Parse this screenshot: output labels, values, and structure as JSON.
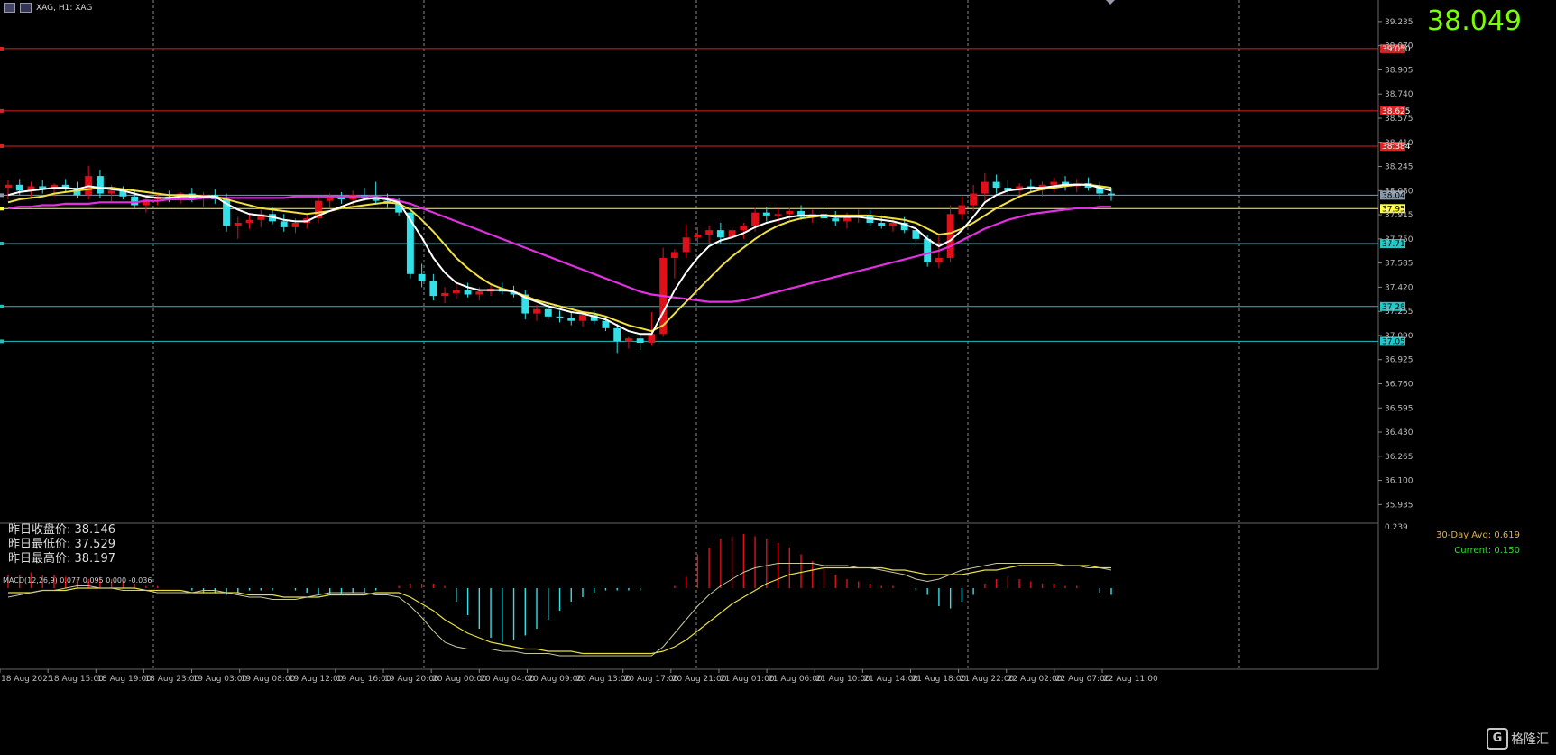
{
  "header": {
    "title": "XAG, H1: XAG"
  },
  "current_price": "38.049",
  "stats": {
    "prev_close": "昨日收盘价: 38.146",
    "prev_low": "昨日最低价: 37.529",
    "prev_high": "昨日最高价: 38.197"
  },
  "avg_panel": {
    "avg30": "30-Day Avg: 0.619",
    "current": "Current: 0.150"
  },
  "macd": {
    "label": "MACD(12,26,9) 0.077 0.095 0.000 -0.036",
    "top_tick": "0.239"
  },
  "watermark": {
    "text": "格隆汇",
    "mark": "G"
  },
  "colors": {
    "bg": "#000000",
    "bull": "#e0101a",
    "bear": "#33e0e8",
    "ma_fast": "#ffffff",
    "ma_mid": "#f0e040",
    "ma_slow": "#e030e0",
    "res_line": "#dd2020",
    "sup_line": "#20c0c0",
    "cur_line": "#8899aa",
    "ma_line": "#ffff44"
  },
  "chart_data": {
    "type": "candlestick",
    "symbol": "XAG",
    "timeframe": "H1",
    "ylim": [
      35.82,
      39.37
    ],
    "y_ticks": [
      "39.235",
      "39.070",
      "38.905",
      "38.740",
      "38.575",
      "38.410",
      "38.245",
      "38.080",
      "37.915",
      "37.750",
      "37.585",
      "37.420",
      "37.255",
      "37.090",
      "36.925",
      "36.760",
      "36.595",
      "36.430",
      "36.265",
      "36.100",
      "35.935"
    ],
    "x_labels": [
      "18 Aug 2025",
      "18 Aug 15:00",
      "18 Aug 19:00",
      "18 Aug 23:00",
      "19 Aug 03:00",
      "19 Aug 08:00",
      "19 Aug 12:00",
      "19 Aug 16:00",
      "19 Aug 20:00",
      "20 Aug 00:00",
      "20 Aug 04:00",
      "20 Aug 09:00",
      "20 Aug 13:00",
      "20 Aug 17:00",
      "20 Aug 21:00",
      "21 Aug 01:00",
      "21 Aug 06:00",
      "21 Aug 10:00",
      "21 Aug 14:00",
      "21 Aug 18:00",
      "21 Aug 22:00",
      "22 Aug 02:00",
      "22 Aug 07:00",
      "22 Aug 11:00"
    ],
    "h_levels": [
      {
        "value": 39.05,
        "label": "39.050",
        "kind": "res"
      },
      {
        "value": 38.625,
        "label": "38.625",
        "kind": "res"
      },
      {
        "value": 38.384,
        "label": "38.384",
        "kind": "res"
      },
      {
        "value": 38.049,
        "label": "38.049",
        "kind": "cur"
      },
      {
        "value": 37.957,
        "label": "37.957",
        "kind": "ma"
      },
      {
        "value": 37.718,
        "label": "37.718",
        "kind": "sup"
      },
      {
        "value": 37.288,
        "label": "37.288",
        "kind": "sup"
      },
      {
        "value": 37.05,
        "label": "37.050",
        "kind": "sup"
      }
    ],
    "candles": [
      [
        38.1,
        38.15,
        38.02,
        38.12
      ],
      [
        38.12,
        38.16,
        38.05,
        38.08
      ],
      [
        38.08,
        38.14,
        38.03,
        38.11
      ],
      [
        38.11,
        38.15,
        38.06,
        38.09
      ],
      [
        38.09,
        38.13,
        38.04,
        38.12
      ],
      [
        38.12,
        38.16,
        38.07,
        38.1
      ],
      [
        38.1,
        38.14,
        38.03,
        38.05
      ],
      [
        38.05,
        38.25,
        38.02,
        38.18
      ],
      [
        38.18,
        38.22,
        38.03,
        38.06
      ],
      [
        38.06,
        38.12,
        38.0,
        38.08
      ],
      [
        38.08,
        38.11,
        38.02,
        38.04
      ],
      [
        38.04,
        38.08,
        37.96,
        37.98
      ],
      [
        37.98,
        38.05,
        37.93,
        38.02
      ],
      [
        38.02,
        38.06,
        37.98,
        38.04
      ],
      [
        38.04,
        38.08,
        38.0,
        38.02
      ],
      [
        38.02,
        38.07,
        37.99,
        38.06
      ],
      [
        38.06,
        38.1,
        38.0,
        38.03
      ],
      [
        38.03,
        38.07,
        37.97,
        38.05
      ],
      [
        38.05,
        38.09,
        37.99,
        38.02
      ],
      [
        38.02,
        38.06,
        37.8,
        37.84
      ],
      [
        37.84,
        37.9,
        37.75,
        37.86
      ],
      [
        37.86,
        37.92,
        37.82,
        37.88
      ],
      [
        37.88,
        37.95,
        37.83,
        37.92
      ],
      [
        37.92,
        37.97,
        37.85,
        37.87
      ],
      [
        37.87,
        37.92,
        37.8,
        37.83
      ],
      [
        37.83,
        37.89,
        37.79,
        37.86
      ],
      [
        37.86,
        37.92,
        37.82,
        37.89
      ],
      [
        37.89,
        38.04,
        37.86,
        38.01
      ],
      [
        38.01,
        38.06,
        37.96,
        38.04
      ],
      [
        38.04,
        38.07,
        37.99,
        38.02
      ],
      [
        38.02,
        38.08,
        37.98,
        38.05
      ],
      [
        38.05,
        38.1,
        38.01,
        38.03
      ],
      [
        38.03,
        38.14,
        37.99,
        38.01
      ],
      [
        38.01,
        38.06,
        37.96,
        37.99
      ],
      [
        37.99,
        38.03,
        37.91,
        37.93
      ],
      [
        37.93,
        37.97,
        37.48,
        37.51
      ],
      [
        37.51,
        37.58,
        37.42,
        37.46
      ],
      [
        37.46,
        37.51,
        37.33,
        37.36
      ],
      [
        37.36,
        37.42,
        37.31,
        37.38
      ],
      [
        37.38,
        37.44,
        37.34,
        37.4
      ],
      [
        37.4,
        37.45,
        37.35,
        37.37
      ],
      [
        37.37,
        37.42,
        37.33,
        37.39
      ],
      [
        37.39,
        37.44,
        37.36,
        37.41
      ],
      [
        37.41,
        37.45,
        37.37,
        37.39
      ],
      [
        37.39,
        37.43,
        37.35,
        37.37
      ],
      [
        37.37,
        37.4,
        37.2,
        37.24
      ],
      [
        37.24,
        37.3,
        37.19,
        37.27
      ],
      [
        37.27,
        37.31,
        37.2,
        37.22
      ],
      [
        37.22,
        37.26,
        37.18,
        37.21
      ],
      [
        37.21,
        37.25,
        37.16,
        37.19
      ],
      [
        37.19,
        37.25,
        37.15,
        37.23
      ],
      [
        37.23,
        37.26,
        37.17,
        37.19
      ],
      [
        37.19,
        37.22,
        37.12,
        37.14
      ],
      [
        37.14,
        37.17,
        36.97,
        37.05
      ],
      [
        37.05,
        37.08,
        37.0,
        37.07
      ],
      [
        37.07,
        37.1,
        36.99,
        37.04
      ],
      [
        37.04,
        37.25,
        37.02,
        37.1
      ],
      [
        37.1,
        37.69,
        37.08,
        37.62
      ],
      [
        37.62,
        37.68,
        37.48,
        37.66
      ],
      [
        37.66,
        37.85,
        37.62,
        37.76
      ],
      [
        37.76,
        37.83,
        37.7,
        37.78
      ],
      [
        37.78,
        37.84,
        37.72,
        37.81
      ],
      [
        37.81,
        37.86,
        37.72,
        37.76
      ],
      [
        37.76,
        37.83,
        37.72,
        37.81
      ],
      [
        37.81,
        37.86,
        37.75,
        37.84
      ],
      [
        37.84,
        37.96,
        37.8,
        37.93
      ],
      [
        37.93,
        37.97,
        37.87,
        37.91
      ],
      [
        37.91,
        37.96,
        37.86,
        37.92
      ],
      [
        37.92,
        37.96,
        37.88,
        37.94
      ],
      [
        37.94,
        37.98,
        37.88,
        37.9
      ],
      [
        37.9,
        37.95,
        37.86,
        37.92
      ],
      [
        37.92,
        37.97,
        37.87,
        37.89
      ],
      [
        37.89,
        37.94,
        37.84,
        37.87
      ],
      [
        37.87,
        37.93,
        37.82,
        37.9
      ],
      [
        37.9,
        37.95,
        37.86,
        37.91
      ],
      [
        37.91,
        37.95,
        37.84,
        37.86
      ],
      [
        37.86,
        37.91,
        37.82,
        37.84
      ],
      [
        37.84,
        37.89,
        37.8,
        37.86
      ],
      [
        37.86,
        37.9,
        37.79,
        37.81
      ],
      [
        37.81,
        37.85,
        37.7,
        37.75
      ],
      [
        37.75,
        37.78,
        37.56,
        37.59
      ],
      [
        37.59,
        37.78,
        37.55,
        37.62
      ],
      [
        37.62,
        37.98,
        37.59,
        37.92
      ],
      [
        37.92,
        38.04,
        37.88,
        37.98
      ],
      [
        37.98,
        38.12,
        37.94,
        38.06
      ],
      [
        38.06,
        38.2,
        38.01,
        38.14
      ],
      [
        38.14,
        38.19,
        38.06,
        38.1
      ],
      [
        38.1,
        38.15,
        38.05,
        38.08
      ],
      [
        38.08,
        38.13,
        38.04,
        38.11
      ],
      [
        38.11,
        38.16,
        38.07,
        38.09
      ],
      [
        38.09,
        38.14,
        38.04,
        38.12
      ],
      [
        38.12,
        38.17,
        38.07,
        38.14
      ],
      [
        38.14,
        38.18,
        38.08,
        38.11
      ],
      [
        38.11,
        38.16,
        38.07,
        38.13
      ],
      [
        38.13,
        38.17,
        38.08,
        38.1
      ],
      [
        38.1,
        38.14,
        38.02,
        38.06
      ],
      [
        38.06,
        38.1,
        38.01,
        38.05
      ]
    ],
    "ma_fast": [
      38.05,
      38.07,
      38.08,
      38.09,
      38.1,
      38.1,
      38.09,
      38.11,
      38.1,
      38.09,
      38.08,
      38.06,
      38.04,
      38.03,
      38.03,
      38.04,
      38.04,
      38.04,
      38.04,
      37.99,
      37.95,
      37.92,
      37.91,
      37.9,
      37.88,
      37.87,
      37.87,
      37.91,
      37.94,
      37.97,
      38.0,
      38.02,
      38.03,
      38.02,
      38.0,
      37.88,
      37.76,
      37.62,
      37.52,
      37.45,
      37.42,
      37.4,
      37.4,
      37.4,
      37.39,
      37.35,
      37.32,
      37.29,
      37.27,
      37.25,
      37.24,
      37.22,
      37.2,
      37.16,
      37.12,
      37.1,
      37.1,
      37.25,
      37.4,
      37.52,
      37.62,
      37.7,
      37.74,
      37.76,
      37.79,
      37.83,
      37.86,
      37.88,
      37.9,
      37.91,
      37.91,
      37.91,
      37.9,
      37.9,
      37.9,
      37.89,
      37.88,
      37.87,
      37.85,
      37.82,
      37.75,
      37.7,
      37.74,
      37.81,
      37.9,
      38.0,
      38.05,
      38.08,
      38.09,
      38.1,
      38.1,
      38.11,
      38.12,
      38.12,
      38.12,
      38.1,
      38.08
    ],
    "ma_mid": [
      38.0,
      38.02,
      38.03,
      38.04,
      38.06,
      38.07,
      38.08,
      38.09,
      38.1,
      38.1,
      38.09,
      38.08,
      38.07,
      38.06,
      38.05,
      38.05,
      38.05,
      38.04,
      38.04,
      38.02,
      38.0,
      37.98,
      37.96,
      37.95,
      37.94,
      37.93,
      37.92,
      37.93,
      37.94,
      37.96,
      37.97,
      37.98,
      37.99,
      38.0,
      37.99,
      37.95,
      37.88,
      37.8,
      37.71,
      37.62,
      37.55,
      37.49,
      37.44,
      37.41,
      37.39,
      37.36,
      37.33,
      37.31,
      37.29,
      37.27,
      37.25,
      37.24,
      37.22,
      37.19,
      37.16,
      37.14,
      37.12,
      37.16,
      37.24,
      37.32,
      37.4,
      37.48,
      37.56,
      37.63,
      37.69,
      37.75,
      37.8,
      37.84,
      37.87,
      37.89,
      37.9,
      37.91,
      37.91,
      37.91,
      37.91,
      37.91,
      37.9,
      37.89,
      37.88,
      37.86,
      37.82,
      37.78,
      37.79,
      37.82,
      37.86,
      37.91,
      37.96,
      38.0,
      38.04,
      38.07,
      38.09,
      38.1,
      38.11,
      38.12,
      38.12,
      38.11,
      38.1
    ],
    "ma_slow": [
      37.96,
      37.97,
      37.97,
      37.98,
      37.98,
      37.99,
      37.99,
      37.99,
      38.0,
      38.0,
      38.0,
      38.0,
      38.01,
      38.01,
      38.02,
      38.02,
      38.02,
      38.03,
      38.03,
      38.03,
      38.03,
      38.03,
      38.03,
      38.03,
      38.03,
      38.04,
      38.04,
      38.04,
      38.04,
      38.04,
      38.04,
      38.04,
      38.04,
      38.03,
      38.01,
      37.99,
      37.96,
      37.93,
      37.9,
      37.87,
      37.84,
      37.81,
      37.78,
      37.75,
      37.72,
      37.69,
      37.66,
      37.63,
      37.6,
      37.57,
      37.54,
      37.51,
      37.48,
      37.45,
      37.42,
      37.39,
      37.37,
      37.36,
      37.35,
      37.34,
      37.33,
      37.32,
      37.32,
      37.32,
      37.33,
      37.35,
      37.37,
      37.39,
      37.41,
      37.43,
      37.45,
      37.47,
      37.49,
      37.51,
      37.53,
      37.55,
      37.57,
      37.59,
      37.61,
      37.63,
      37.65,
      37.67,
      37.7,
      37.74,
      37.78,
      37.82,
      37.85,
      37.88,
      37.9,
      37.92,
      37.93,
      37.94,
      37.95,
      37.96,
      37.96,
      37.97,
      37.97
    ],
    "macd_ylim": [
      -0.36,
      0.28
    ],
    "macd_hist": [
      0.06,
      0.06,
      0.07,
      0.06,
      0.06,
      0.05,
      0.04,
      0.04,
      0.05,
      0.04,
      0.03,
      0.02,
      0.01,
      0.01,
      0.0,
      0.0,
      -0.01,
      -0.02,
      -0.02,
      -0.03,
      -0.02,
      -0.01,
      -0.01,
      -0.01,
      0.0,
      -0.01,
      -0.02,
      -0.03,
      -0.03,
      -0.03,
      -0.02,
      -0.02,
      -0.01,
      0.0,
      0.01,
      0.02,
      0.02,
      0.02,
      0.01,
      -0.06,
      -0.12,
      -0.18,
      -0.22,
      -0.24,
      -0.23,
      -0.21,
      -0.18,
      -0.14,
      -0.1,
      -0.06,
      -0.04,
      -0.02,
      -0.01,
      -0.01,
      -0.01,
      -0.01,
      0.0,
      0.0,
      0.01,
      0.05,
      0.15,
      0.18,
      0.22,
      0.23,
      0.24,
      0.23,
      0.22,
      0.2,
      0.18,
      0.15,
      0.12,
      0.09,
      0.06,
      0.04,
      0.03,
      0.02,
      0.01,
      0.01,
      0.0,
      -0.01,
      -0.03,
      -0.08,
      -0.09,
      -0.06,
      -0.03,
      0.02,
      0.04,
      0.05,
      0.04,
      0.03,
      0.02,
      0.02,
      0.01,
      0.01,
      0.0,
      -0.02,
      -0.03
    ],
    "macd_line": [
      -0.04,
      -0.03,
      -0.02,
      -0.01,
      -0.01,
      0.0,
      0.01,
      0.01,
      0.0,
      0.0,
      -0.01,
      -0.01,
      -0.01,
      -0.02,
      -0.02,
      -0.02,
      -0.02,
      -0.01,
      -0.01,
      -0.02,
      -0.03,
      -0.04,
      -0.04,
      -0.05,
      -0.05,
      -0.05,
      -0.04,
      -0.03,
      -0.02,
      -0.02,
      -0.02,
      -0.02,
      -0.03,
      -0.03,
      -0.04,
      -0.08,
      -0.13,
      -0.19,
      -0.24,
      -0.26,
      -0.27,
      -0.27,
      -0.27,
      -0.28,
      -0.28,
      -0.29,
      -0.29,
      -0.29,
      -0.3,
      -0.3,
      -0.3,
      -0.3,
      -0.3,
      -0.3,
      -0.3,
      -0.3,
      -0.3,
      -0.26,
      -0.2,
      -0.14,
      -0.08,
      -0.03,
      0.01,
      0.04,
      0.07,
      0.09,
      0.1,
      0.11,
      0.11,
      0.11,
      0.11,
      0.1,
      0.1,
      0.1,
      0.09,
      0.09,
      0.08,
      0.07,
      0.06,
      0.04,
      0.03,
      0.04,
      0.06,
      0.08,
      0.09,
      0.1,
      0.11,
      0.11,
      0.11,
      0.11,
      0.11,
      0.11,
      0.1,
      0.1,
      0.09,
      0.09,
      0.08
    ],
    "macd_signal": [
      -0.02,
      -0.02,
      -0.02,
      -0.01,
      -0.01,
      -0.01,
      0.0,
      0.0,
      0.0,
      0.0,
      0.0,
      0.0,
      -0.01,
      -0.01,
      -0.01,
      -0.01,
      -0.02,
      -0.02,
      -0.02,
      -0.02,
      -0.02,
      -0.03,
      -0.03,
      -0.03,
      -0.04,
      -0.04,
      -0.04,
      -0.04,
      -0.03,
      -0.03,
      -0.03,
      -0.03,
      -0.02,
      -0.02,
      -0.02,
      -0.04,
      -0.07,
      -0.1,
      -0.14,
      -0.17,
      -0.2,
      -0.22,
      -0.24,
      -0.25,
      -0.26,
      -0.27,
      -0.27,
      -0.28,
      -0.28,
      -0.28,
      -0.29,
      -0.29,
      -0.29,
      -0.29,
      -0.29,
      -0.29,
      -0.29,
      -0.28,
      -0.26,
      -0.23,
      -0.19,
      -0.15,
      -0.11,
      -0.07,
      -0.04,
      -0.01,
      0.02,
      0.04,
      0.06,
      0.07,
      0.08,
      0.09,
      0.09,
      0.09,
      0.09,
      0.09,
      0.09,
      0.08,
      0.08,
      0.07,
      0.06,
      0.06,
      0.06,
      0.06,
      0.07,
      0.08,
      0.08,
      0.09,
      0.1,
      0.1,
      0.1,
      0.1,
      0.1,
      0.1,
      0.1,
      0.09,
      0.09
    ]
  }
}
